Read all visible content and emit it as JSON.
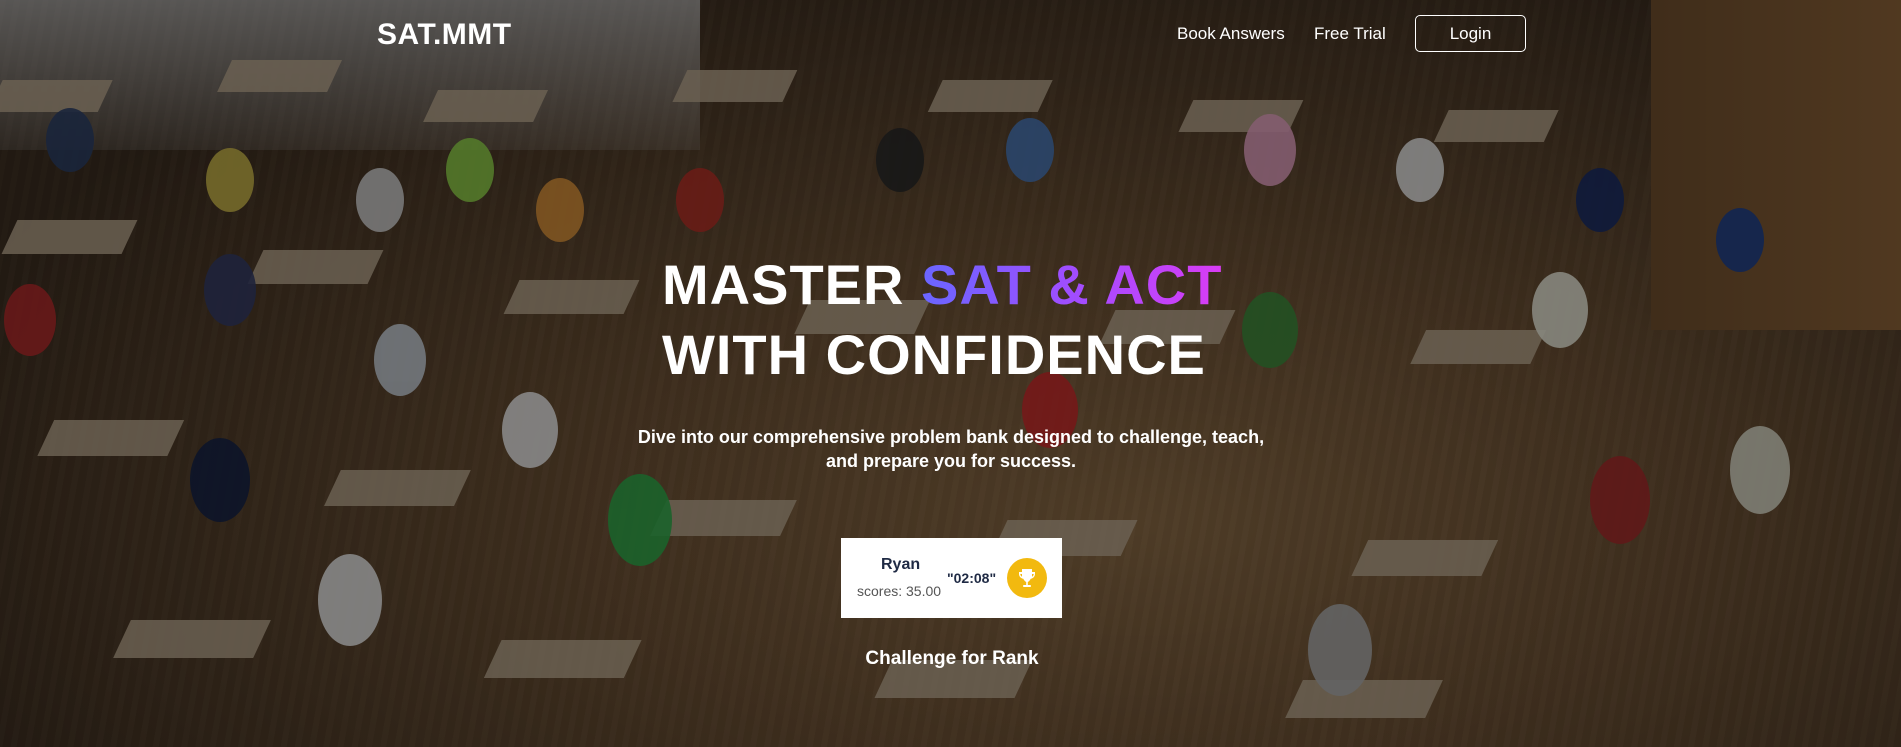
{
  "header": {
    "brand": "SAT.MMT",
    "nav": {
      "book_answers": "Book Answers",
      "free_trial": "Free Trial",
      "login": "Login"
    }
  },
  "hero": {
    "headline_line1_plain": "MASTER ",
    "headline_line1_highlight": "SAT & ACT",
    "headline_line2": "WITH CONFIDENCE",
    "subtitle": "Dive into our comprehensive problem bank designed to challenge, teach, and prepare you for success.",
    "highlight_gradient": [
      "#6a66ff",
      "#a04dff",
      "#d93cf5"
    ]
  },
  "leaderboard_card": {
    "name": "Ryan",
    "score": "scores: 35.00",
    "time": "\"02:08\"",
    "icon": "trophy-icon",
    "icon_color": "#f2b90f"
  },
  "cta": {
    "challenge_label": "Challenge for Rank"
  }
}
